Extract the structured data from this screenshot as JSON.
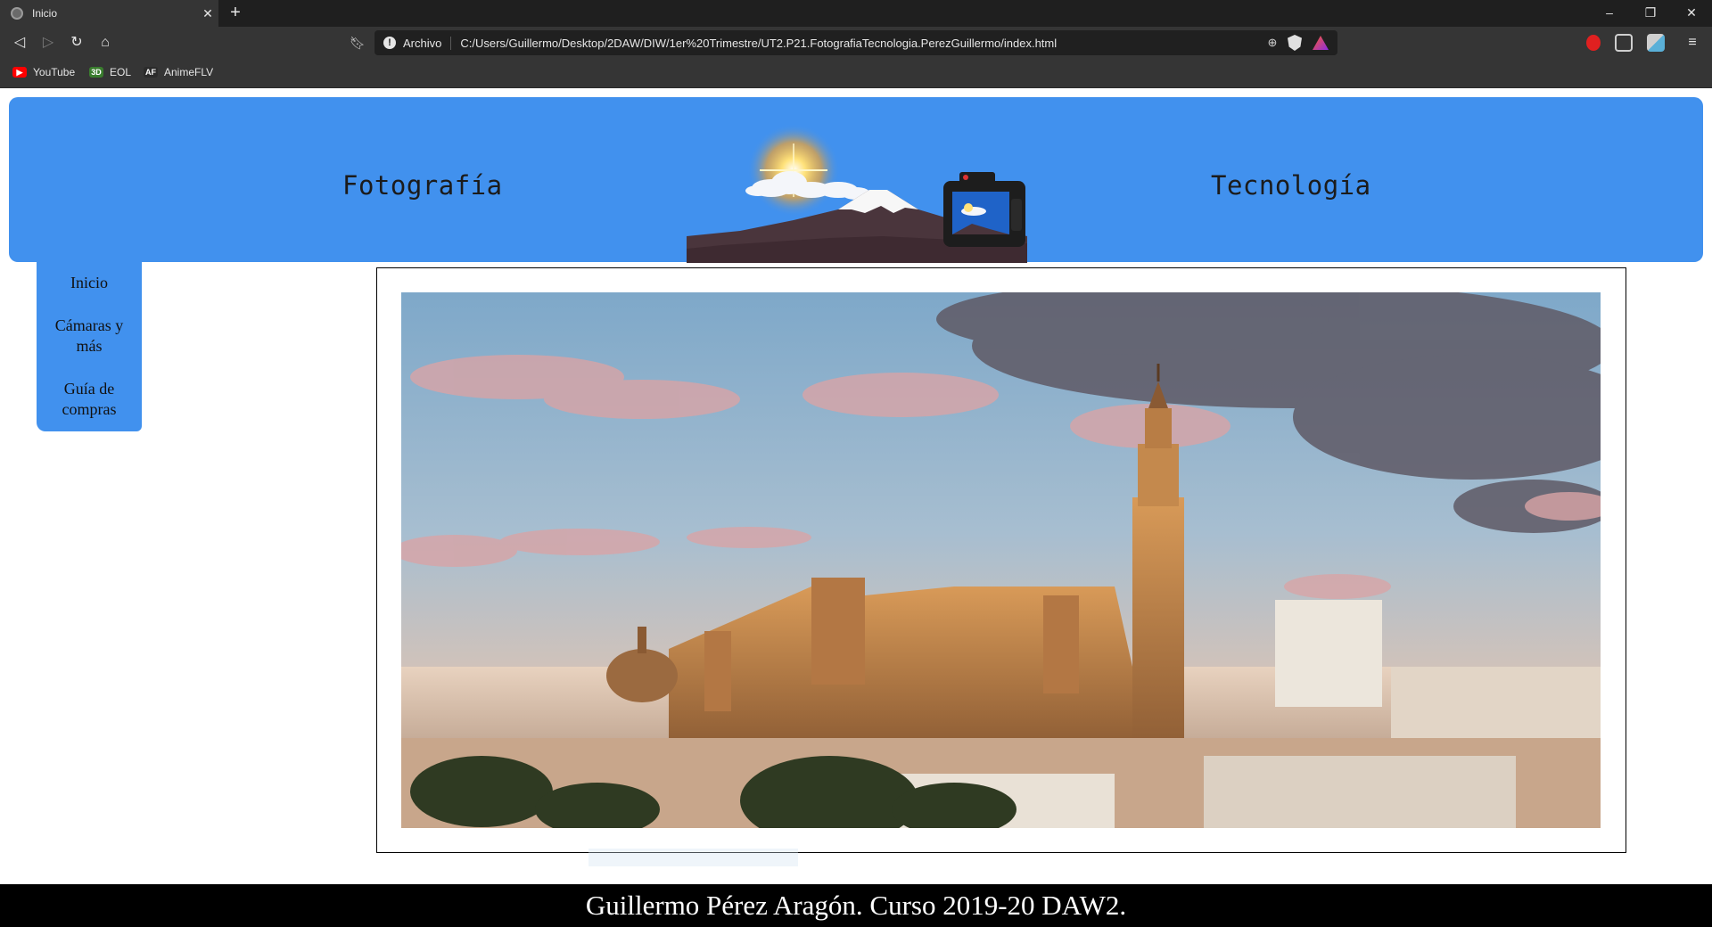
{
  "browser": {
    "tab": {
      "title": "Inicio",
      "close_glyph": "✕"
    },
    "new_tab_glyph": "+",
    "window_controls": {
      "minimize": "–",
      "restore": "❐",
      "close": "✕"
    },
    "nav": {
      "back": "◁",
      "forward": "▷",
      "reload": "↻",
      "home": "⌂"
    },
    "address": {
      "scheme_label": "Archivo",
      "url": "C:/Users/Guillermo/Desktop/2DAW/DIW/1er%20Trimestre/UT2.P21.FotografiaTecnologia.PerezGuillermo/index.html",
      "info_glyph": "!",
      "zoom_glyph": "⊕"
    },
    "menu_glyph": "≡",
    "bookmarks": [
      {
        "label": "YouTube",
        "icon": "youtube-icon",
        "icon_text": "▶",
        "color": "#ff0000"
      },
      {
        "label": "EOL",
        "icon": "eol-icon",
        "icon_text": "3D",
        "color": "#3a7d2e"
      },
      {
        "label": "AnimeFLV",
        "icon": "animeflv-icon",
        "icon_text": "AF",
        "color": "#2b2b2b"
      }
    ]
  },
  "page": {
    "header": {
      "left_title": "Fotografía",
      "right_title": "Tecnología",
      "background": "#4191ee"
    },
    "sidenav": {
      "items": [
        {
          "label": "Inicio"
        },
        {
          "label": "Cámaras y más"
        },
        {
          "label": "Guía de compras"
        }
      ]
    },
    "footer": {
      "text": "Guillermo Pérez Aragón. Curso 2019-20 DAW2."
    }
  }
}
